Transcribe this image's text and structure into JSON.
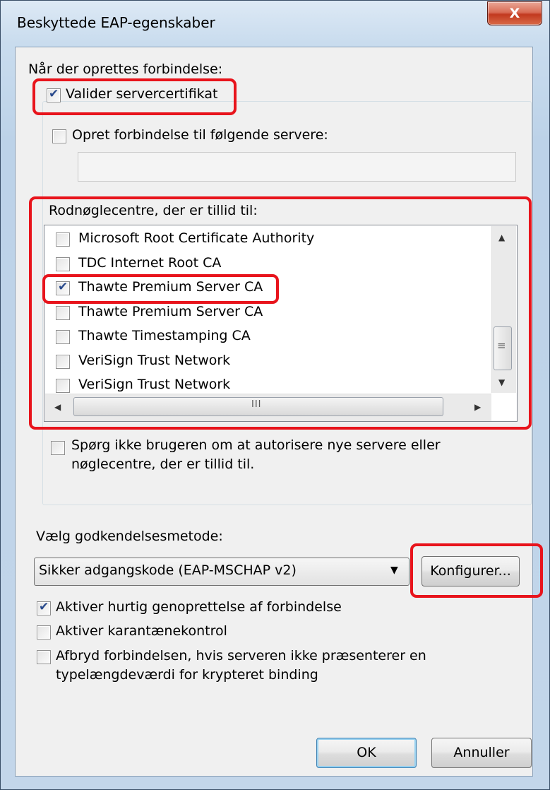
{
  "window": {
    "title": "Beskyttede EAP-egenskaber",
    "close_label": "X"
  },
  "connect": {
    "heading": "Når der oprettes forbindelse:",
    "validate_label": "Valider servercertifikat",
    "validate_checked": true,
    "connect_servers_label": "Opret forbindelse til følgende servere:",
    "connect_servers_checked": false,
    "servers_value": "",
    "roots_label": "Rodnøglecentre, der er tillid til:",
    "roots": [
      {
        "label": "Microsoft Root Certificate Authority",
        "checked": false
      },
      {
        "label": "TDC Internet Root CA",
        "checked": false
      },
      {
        "label": "Thawte Premium Server CA",
        "checked": true
      },
      {
        "label": "Thawte Premium Server CA",
        "checked": false
      },
      {
        "label": "Thawte Timestamping CA",
        "checked": false
      },
      {
        "label": "VeriSign Trust Network",
        "checked": false
      },
      {
        "label": "VeriSign Trust Network",
        "checked": false
      }
    ],
    "scroll_grip": "III",
    "grip_v": "≡",
    "noprompt_label_1": "Spørg ikke brugeren om at autorisere nye servere eller",
    "noprompt_label_2": "nøglecentre, der er tillid til.",
    "noprompt_checked": false
  },
  "auth": {
    "heading": "Vælg godkendelsesmetode:",
    "method_value": "Sikker adgangskode (EAP-MSCHAP v2)",
    "configure_label": "Konfigurer...",
    "fast_reconnect_label": "Aktiver hurtig genoprettelse af forbindelse",
    "fast_reconnect_checked": true,
    "quarantine_label": "Aktiver karantænekontrol",
    "quarantine_checked": false,
    "disconnect_label_1": "Afbryd forbindelsen, hvis serveren ikke præsenterer en",
    "disconnect_label_2": "typelængdeværdi for krypteret binding",
    "disconnect_checked": false
  },
  "buttons": {
    "ok": "OK",
    "cancel": "Annuller"
  },
  "colors": {
    "highlight": "#e8141c",
    "check": "#2a4b8d"
  }
}
